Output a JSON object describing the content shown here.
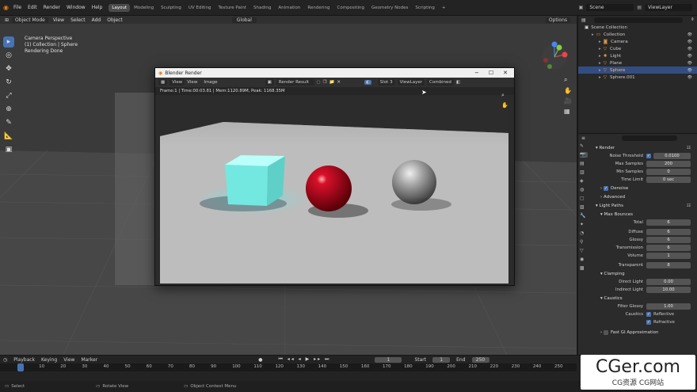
{
  "topbar": {
    "menus": [
      "File",
      "Edit",
      "Render",
      "Window",
      "Help"
    ],
    "workspaces": [
      "Layout",
      "Modeling",
      "Sculpting",
      "UV Editing",
      "Texture Paint",
      "Shading",
      "Animation",
      "Rendering",
      "Compositing",
      "Geometry Nodes",
      "Scripting"
    ],
    "active_workspace": "Layout",
    "plus": "+",
    "scene": "Scene",
    "view_layer": "ViewLayer"
  },
  "header2": {
    "mode": "Object Mode",
    "menus": [
      "View",
      "Select",
      "Add",
      "Object"
    ],
    "transform": "Global",
    "options": "Options"
  },
  "viewport": {
    "overlay": [
      "Camera Perspective",
      "(1) Collection | Sphere",
      "Rendering Done"
    ]
  },
  "render_window": {
    "title": "Blender Render",
    "menus": [
      "View",
      "View",
      "Image"
    ],
    "image": "Render Result",
    "slot": "Slot 3",
    "view_layer": "ViewLayer",
    "pass": "Combined",
    "info": "Frame:1 | Time:00:03.81 | Mem:1120.89M, Peak: 1168.35M"
  },
  "outliner": {
    "header": "Scene Collection",
    "items": [
      {
        "name": "Collection",
        "indent": 1,
        "sel": false,
        "icon": "collection-icon"
      },
      {
        "name": "Camera",
        "indent": 2,
        "sel": false,
        "icon": "camera-icon"
      },
      {
        "name": "Cube",
        "indent": 2,
        "sel": false,
        "icon": "mesh-icon"
      },
      {
        "name": "Light",
        "indent": 2,
        "sel": false,
        "icon": "light-icon"
      },
      {
        "name": "Plane",
        "indent": 2,
        "sel": false,
        "icon": "mesh-icon"
      },
      {
        "name": "Sphere",
        "indent": 2,
        "sel": true,
        "icon": "mesh-icon"
      },
      {
        "name": "Sphere.001",
        "indent": 2,
        "sel": false,
        "icon": "mesh-icon"
      }
    ]
  },
  "props": {
    "render_header": "Render",
    "noise_threshold_label": "Noise Threshold",
    "noise_threshold": "0.0100",
    "max_samples_label": "Max Samples",
    "max_samples": "200",
    "min_samples_label": "Min Samples",
    "min_samples": "0",
    "time_limit_label": "Time Limit",
    "time_limit": "0 sec",
    "denoise": "Denoise",
    "advanced": "Advanced",
    "light_paths": "Light Paths",
    "max_bounces": "Max Bounces",
    "total_label": "Total",
    "total": "6",
    "diffuse_label": "Diffuse",
    "diffuse": "6",
    "glossy_label": "Glossy",
    "glossy": "6",
    "transmission_label": "Transmission",
    "transmission": "6",
    "volume_label": "Volume",
    "volume": "1",
    "transparent_label": "Transparent",
    "transparent": "8",
    "clamping": "Clamping",
    "direct_light_label": "Direct Light",
    "direct_light": "0.00",
    "indirect_light_label": "Indirect Light",
    "indirect_light": "10.00",
    "caustics": "Caustics",
    "filter_glossy_label": "Filter Glossy",
    "filter_glossy": "1.00",
    "caustics_label": "Caustics",
    "reflective": "Reflective",
    "refractive": "Refractive",
    "fast_gi": "Fast GI Approximation"
  },
  "timeline": {
    "menus": [
      "Playback",
      "Keying",
      "View",
      "Marker"
    ],
    "current_frame": "1",
    "start_label": "Start",
    "start": "1",
    "end_label": "End",
    "end": "250",
    "ruler": [
      "0",
      "10",
      "20",
      "30",
      "40",
      "50",
      "60",
      "70",
      "80",
      "90",
      "100",
      "110",
      "120",
      "130",
      "140",
      "150",
      "160",
      "170",
      "180",
      "190",
      "200",
      "210",
      "220",
      "230",
      "240",
      "250"
    ]
  },
  "status": {
    "items": [
      "Select",
      "Rotate View",
      "Object Context Menu"
    ]
  },
  "watermark": {
    "main": "CGer.com",
    "sub": "CG资源 CG网站"
  }
}
